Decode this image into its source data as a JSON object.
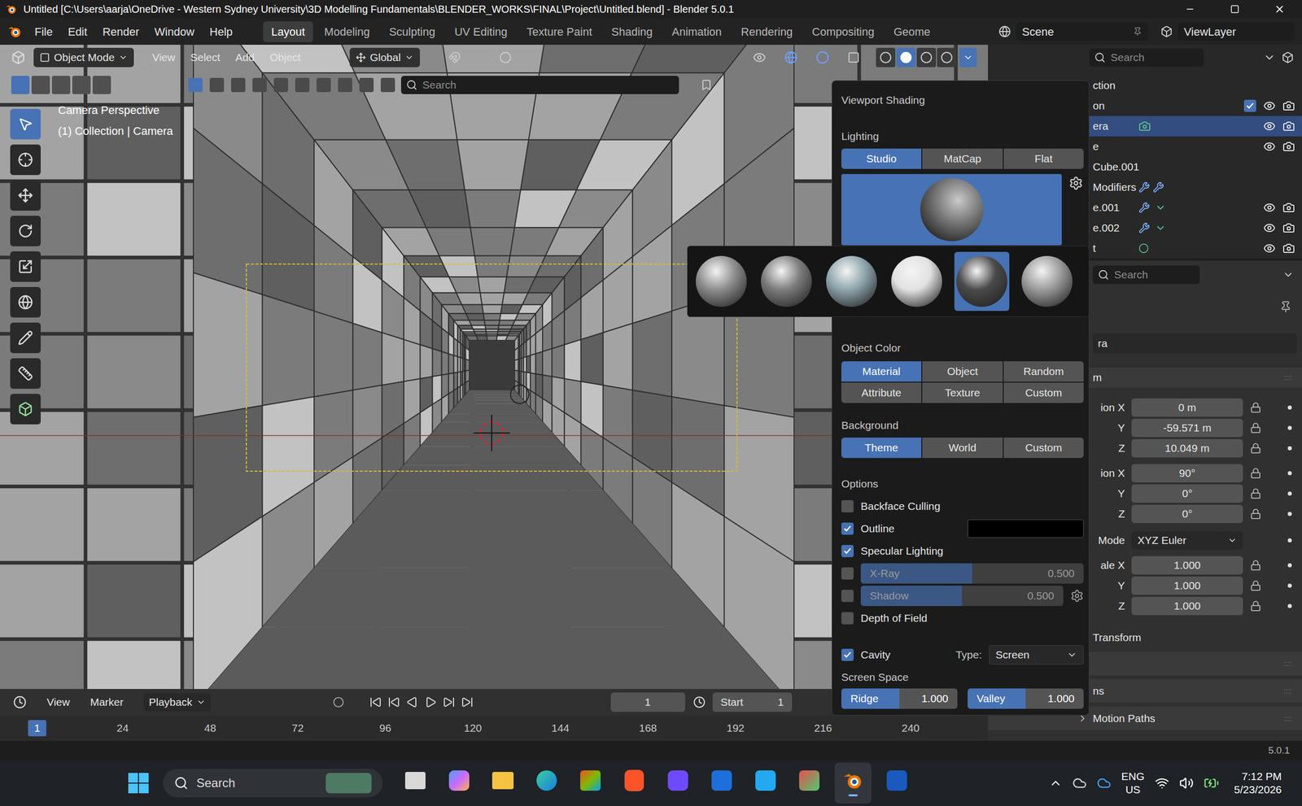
{
  "window": {
    "title": "Untitled [C:\\Users\\aarja\\OneDrive - Western Sydney University\\3D Modelling Fundamentals\\BLENDER_WORKS\\FINAL\\Project\\Untitled.blend] - Blender 5.0.1"
  },
  "menu": [
    "File",
    "Edit",
    "Render",
    "Window",
    "Help"
  ],
  "workspaces": [
    {
      "label": "Layout",
      "selected": true
    },
    {
      "label": "Modeling",
      "selected": false
    },
    {
      "label": "Sculpting",
      "selected": false
    },
    {
      "label": "UV Editing",
      "selected": false
    },
    {
      "label": "Texture Paint",
      "selected": false
    },
    {
      "label": "Shading",
      "selected": false
    },
    {
      "label": "Animation",
      "selected": false
    },
    {
      "label": "Rendering",
      "selected": false
    },
    {
      "label": "Compositing",
      "selected": false
    },
    {
      "label": "Geome",
      "selected": false
    }
  ],
  "scene": "Scene",
  "view_layer": "ViewLayer",
  "viewport_header": {
    "mode": "Object Mode",
    "menus": [
      "View",
      "Select",
      "Add",
      "Object"
    ],
    "orientation": "Global"
  },
  "shading_buttons": [
    {
      "kind": "wireframe",
      "selected": false
    },
    {
      "kind": "solid",
      "selected": true
    },
    {
      "kind": "material",
      "selected": false
    },
    {
      "kind": "rendered",
      "selected": false
    }
  ],
  "tool_header": {
    "search_placeholder": "Search"
  },
  "viewport": {
    "overlay_lines": [
      "Camera Perspective",
      "(1) Collection | Camera"
    ]
  },
  "shading_popover": {
    "title": "Viewport Shading",
    "lighting": {
      "label": "Lighting",
      "options": [
        {
          "label": "Studio",
          "selected": true
        },
        {
          "label": "MatCap",
          "selected": false
        },
        {
          "label": "Flat",
          "selected": false
        }
      ]
    },
    "object_color": {
      "label": "Object Color",
      "options": [
        {
          "label": "Material",
          "selected": true
        },
        {
          "label": "Object",
          "selected": false
        },
        {
          "label": "Random",
          "selected": false
        },
        {
          "label": "Attribute",
          "selected": false
        },
        {
          "label": "Texture",
          "selected": false
        },
        {
          "label": "Custom",
          "selected": false
        }
      ]
    },
    "background": {
      "label": "Background",
      "options": [
        {
          "label": "Theme",
          "selected": true
        },
        {
          "label": "World",
          "selected": false
        },
        {
          "label": "Custom",
          "selected": false
        }
      ]
    },
    "options": {
      "label": "Options",
      "items": [
        {
          "kind": "check",
          "label": "Backface Culling",
          "checked": false
        },
        {
          "kind": "color",
          "label": "Outline",
          "checked": true,
          "color": "#000000"
        },
        {
          "kind": "check",
          "label": "Specular Lighting",
          "checked": true
        },
        {
          "kind": "slider",
          "label": "X-Ray",
          "checked": false,
          "value": "0.500",
          "level": 0.5
        },
        {
          "kind": "slider-settings",
          "label": "Shadow",
          "checked": false,
          "value": "0.500",
          "level": 0.5
        },
        {
          "kind": "check",
          "label": "Depth of Field",
          "checked": false
        }
      ]
    },
    "cavity": {
      "label": "Cavity",
      "checked": true,
      "type_label": "Type:",
      "value": "Screen"
    },
    "screen_space": {
      "label": "Screen Space",
      "fields": [
        {
          "label": "Ridge",
          "value": "1.000",
          "level": 0.5
        },
        {
          "label": "Valley",
          "value": "1.000",
          "level": 0.5
        }
      ]
    }
  },
  "matcaps": [
    {
      "selected": false,
      "color": "#8e8e8e"
    },
    {
      "selected": false,
      "color": "#7d7d7d"
    },
    {
      "selected": false,
      "color": "#8fa6ad"
    },
    {
      "selected": false,
      "color": "#e2e2e2"
    },
    {
      "selected": true,
      "color": "#4a4a4a"
    },
    {
      "selected": false,
      "color": "#9c9c9c"
    }
  ],
  "outliner": {
    "search_placeholder": "Search",
    "items": [
      {
        "label": "ction",
        "selected": false,
        "toggles": false,
        "checked": false
      },
      {
        "label": "on",
        "selected": false,
        "toggles": true,
        "checked": true
      },
      {
        "label": "era",
        "selected": true,
        "toggles": true,
        "checked": false
      },
      {
        "label": "e",
        "selected": false,
        "toggles": true,
        "checked": false
      },
      {
        "label": "Cube.001",
        "selected": false,
        "toggles": false,
        "checked": false
      },
      {
        "label": "Modifiers",
        "selected": false,
        "toggles": false,
        "checked": false
      },
      {
        "label": "e.001",
        "selected": false,
        "toggles": true,
        "checked": false
      },
      {
        "label": "e.002",
        "selected": false,
        "toggles": true,
        "checked": false
      },
      {
        "label": "t",
        "selected": false,
        "toggles": true,
        "checked": false
      }
    ]
  },
  "properties": {
    "search_placeholder": "Search",
    "name": "ra",
    "section": "m",
    "groups": [
      [
        {
          "label": "ion X",
          "value": "0 m"
        },
        {
          "label": "Y",
          "value": "-59.571 m"
        },
        {
          "label": "Z",
          "value": "10.049 m"
        }
      ],
      [
        {
          "label": "ion X",
          "value": "90°"
        },
        {
          "label": "Y",
          "value": "0°"
        },
        {
          "label": "Z",
          "value": "0°"
        }
      ],
      [
        {
          "label": "Mode",
          "value": "XYZ Euler",
          "kind": "select"
        }
      ],
      [
        {
          "label": "ale X",
          "value": "1.000"
        },
        {
          "label": "Y",
          "value": "1.000"
        },
        {
          "label": "Z",
          "value": "1.000"
        }
      ]
    ],
    "subpanel": "Transform",
    "panels": [
      "",
      "ns",
      "Motion Paths"
    ]
  },
  "timeline": {
    "menus": [
      "View",
      "Marker",
      "Playback"
    ],
    "current_frame": "1",
    "start_label": "Start",
    "start": "1",
    "current_marker": "1",
    "ruler": [
      "24",
      "48",
      "72",
      "96",
      "120",
      "144",
      "168",
      "192",
      "216",
      "240"
    ]
  },
  "status": "5.0.1",
  "taskbar": {
    "search": "Search",
    "lang": [
      "ENG",
      "US"
    ],
    "time": "7:12 PM",
    "date": "5/23/2026"
  }
}
